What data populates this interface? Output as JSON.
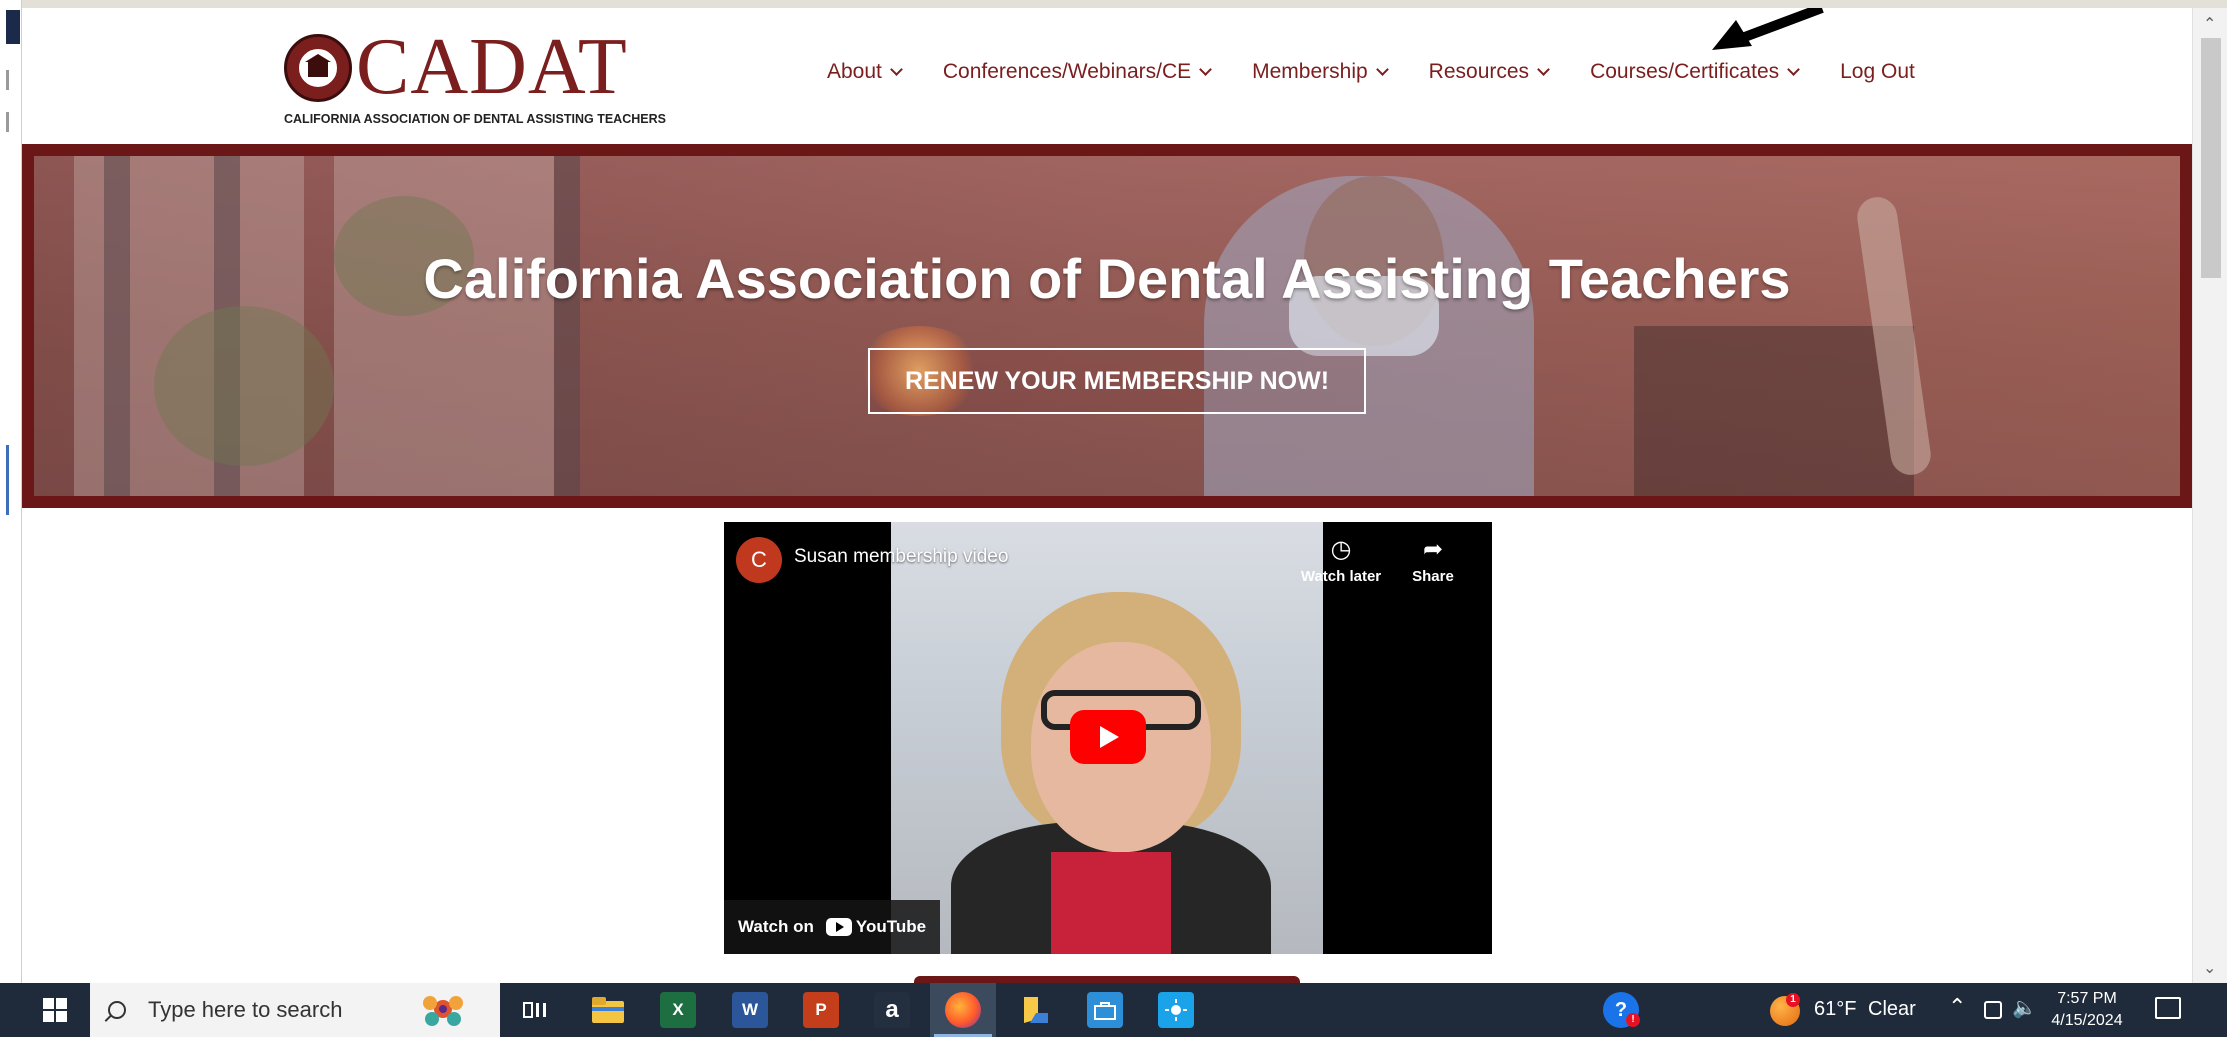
{
  "site": {
    "logo_word": "CADAT",
    "logo_subtitle": "CALIFORNIA ASSOCIATION OF DENTAL ASSISTING TEACHERS",
    "brand_color": "#7a1e1e"
  },
  "nav": {
    "items": [
      {
        "label": "About",
        "has_dropdown": true
      },
      {
        "label": "Conferences/Webinars/CE",
        "has_dropdown": true
      },
      {
        "label": "Membership",
        "has_dropdown": true
      },
      {
        "label": "Resources",
        "has_dropdown": true
      },
      {
        "label": "Courses/Certificates",
        "has_dropdown": true
      },
      {
        "label": "Log Out",
        "has_dropdown": false
      }
    ]
  },
  "hero": {
    "title": "California Association of Dental Assisting Teachers",
    "button_label": "RENEW YOUR MEMBERSHIP NOW!"
  },
  "video": {
    "channel_initial": "C",
    "title": "Susan membership video",
    "watch_later_label": "Watch later",
    "share_label": "Share",
    "watch_on_label": "Watch on",
    "youtube_label": "YouTube"
  },
  "taskbar": {
    "search_placeholder": "Type here to search",
    "apps": [
      "task-view-icon",
      "file-explorer-icon",
      "excel-icon",
      "word-icon",
      "powerpoint-icon",
      "amazon-icon",
      "firefox-icon",
      "sticky-notes-icon",
      "microsoft-store-icon",
      "weather-app-icon"
    ],
    "help_badge": "!",
    "weather_badge": "1",
    "weather_temp": "61°F",
    "weather_condition": "Clear",
    "time": "7:57 PM",
    "date": "4/15/2024"
  }
}
